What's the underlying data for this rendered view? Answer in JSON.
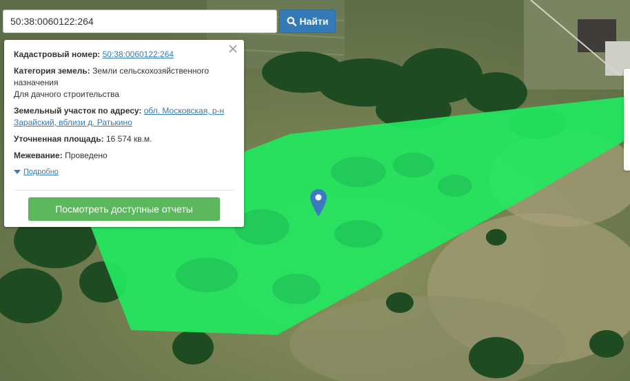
{
  "search": {
    "value": "50:38:0060122:264",
    "button_label": "Найти",
    "button_icon": "search-icon"
  },
  "popup": {
    "close_icon": "close-icon",
    "cadastral_label": "Кадастровый номер:",
    "cadastral_value": "50:38:0060122:264",
    "category_label": "Категория земель:",
    "category_value": "Земли сельскохозяйственного назначения",
    "category_use": "Для дачного строительства",
    "address_label": "Земельный участок по адресу:",
    "address_value": "обл. Московская, р-н Зарайский, вблизи д. Ратькино",
    "area_label": "Уточненная площадь:",
    "area_value": "16 574 кв.м.",
    "survey_label": "Межевание:",
    "survey_value": "Проведено",
    "more_label": "Подробно",
    "more_icon": "caret-down-icon",
    "reports_button": "Посмотреть доступные отчеты"
  },
  "map": {
    "parcel_color": "#22e860",
    "pin_color": "#3a7bbf",
    "pin_icon": "map-marker-icon"
  }
}
